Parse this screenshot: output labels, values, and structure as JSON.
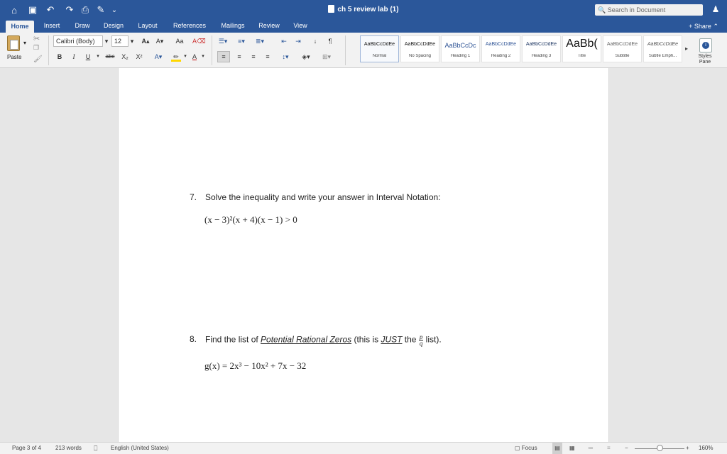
{
  "window": {
    "title": "ch 5 review lab (1)",
    "search_placeholder": "Search in Document",
    "share_label": "Share"
  },
  "quick_access": [
    {
      "name": "home-icon",
      "glyph": "⌂"
    },
    {
      "name": "save-icon",
      "glyph": "▣"
    },
    {
      "name": "undo-icon",
      "glyph": "↶"
    },
    {
      "name": "redo-icon",
      "glyph": "↷"
    },
    {
      "name": "print-icon",
      "glyph": "⎙"
    },
    {
      "name": "edit-icon",
      "glyph": "✎"
    },
    {
      "name": "customize-icon",
      "glyph": "⌄"
    }
  ],
  "tabs": [
    "Home",
    "Insert",
    "Draw",
    "Design",
    "Layout",
    "References",
    "Mailings",
    "Review",
    "View"
  ],
  "active_tab": "Home",
  "ribbon": {
    "paste_label": "Paste",
    "font_name": "Calibri (Body)",
    "font_size": "12",
    "strike_label": "abc",
    "bold": "B",
    "italic": "I",
    "underline": "U",
    "styles": [
      {
        "preview": "AaBbCcDdEe",
        "name": "Normal"
      },
      {
        "preview": "AaBbCcDdEe",
        "name": "No Spacing"
      },
      {
        "preview": "AaBbCcDc",
        "name": "Heading 1"
      },
      {
        "preview": "AaBbCcDdEe",
        "name": "Heading 2"
      },
      {
        "preview": "AaBbCcDdEe",
        "name": "Heading 3"
      },
      {
        "preview": "AaBb(",
        "name": "Title"
      },
      {
        "preview": "AaBbCcDdEe",
        "name": "Subtitle"
      },
      {
        "preview": "AaBbCcDdEe",
        "name": "Subtle Emph..."
      }
    ],
    "styles_pane_label": "Styles Pane"
  },
  "document": {
    "q7": {
      "number": "7.",
      "text": "Solve the inequality and write your answer in Interval Notation:",
      "math": "(x − 3)²(x + 4)(x − 1) > 0"
    },
    "q8": {
      "number": "8.",
      "text_before": "Find the list of ",
      "text_link": "Potential Rational Zeros",
      "text_mid": " (this is ",
      "text_just": "JUST",
      "text_the": " the ",
      "frac_num": "p",
      "frac_den": "q",
      "text_after": " list).",
      "math": "g(x) = 2x³ − 10x² + 7x − 32"
    }
  },
  "status": {
    "page": "Page 3 of 4",
    "words": "213 words",
    "language": "English (United States)",
    "focus": "Focus",
    "zoom": "160%"
  },
  "colors": {
    "accent": "#2b579a",
    "highlight": "#ffd700",
    "font_color": "#c00000"
  }
}
